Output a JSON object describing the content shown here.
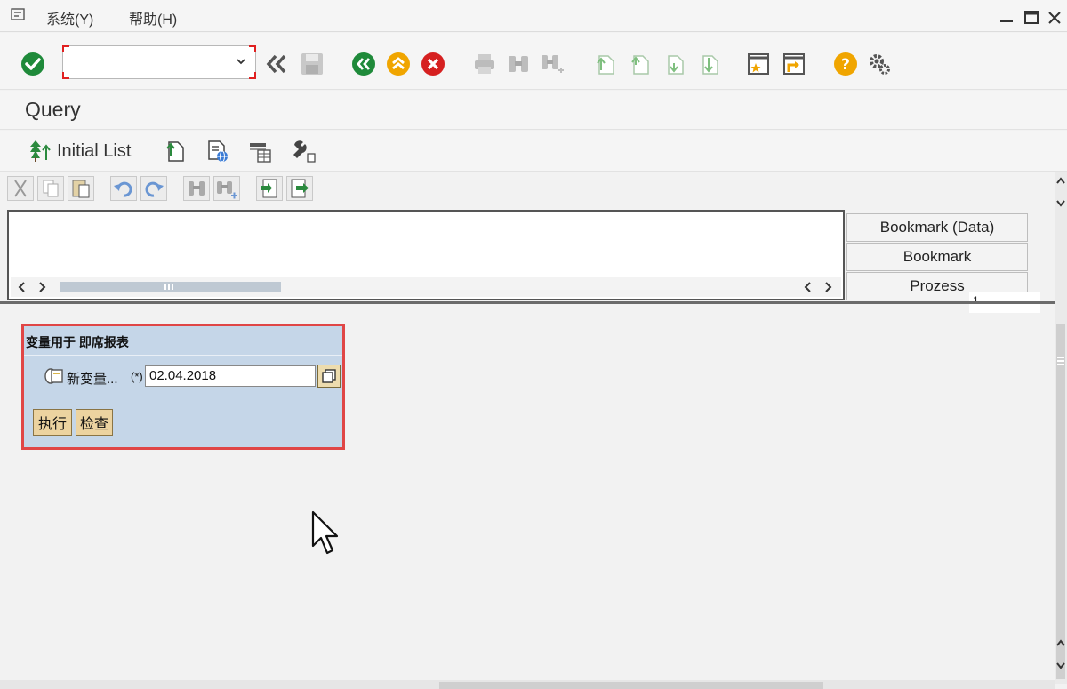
{
  "menubar": {
    "items": [
      {
        "label": "系统(Y)"
      },
      {
        "label": "帮助(H)"
      }
    ]
  },
  "toolbar": {
    "command_field_value": "",
    "icons": [
      "enter-icon",
      "back-arrows-icon",
      "save-icon",
      "back-icon",
      "exit-icon",
      "cancel-icon",
      "print-icon",
      "find-icon",
      "find-next-icon",
      "first-page-icon",
      "previous-page-icon",
      "next-page-icon",
      "last-page-icon",
      "create-session-icon",
      "shortcut-icon",
      "help-icon",
      "settings-icon"
    ]
  },
  "title": "Query",
  "app_toolbar": {
    "initial_list_label": "Initial List"
  },
  "tabs": [
    {
      "label": "Bookmark (Data)"
    },
    {
      "label": "Bookmark"
    },
    {
      "label": "Prozess"
    }
  ],
  "tab_indicator": "1",
  "variables_dialog": {
    "title": "变量用于 即席报表",
    "field_label": "新变量...",
    "required_marker": "(*)",
    "field_value": "02.04.2018",
    "execute_label": "执行",
    "check_label": "检查"
  },
  "colors": {
    "green": "#1f8a3a",
    "orange": "#f0a500",
    "red": "#d62020",
    "highlight": "#e04646",
    "dialog_bg": "#c5d6e8"
  }
}
